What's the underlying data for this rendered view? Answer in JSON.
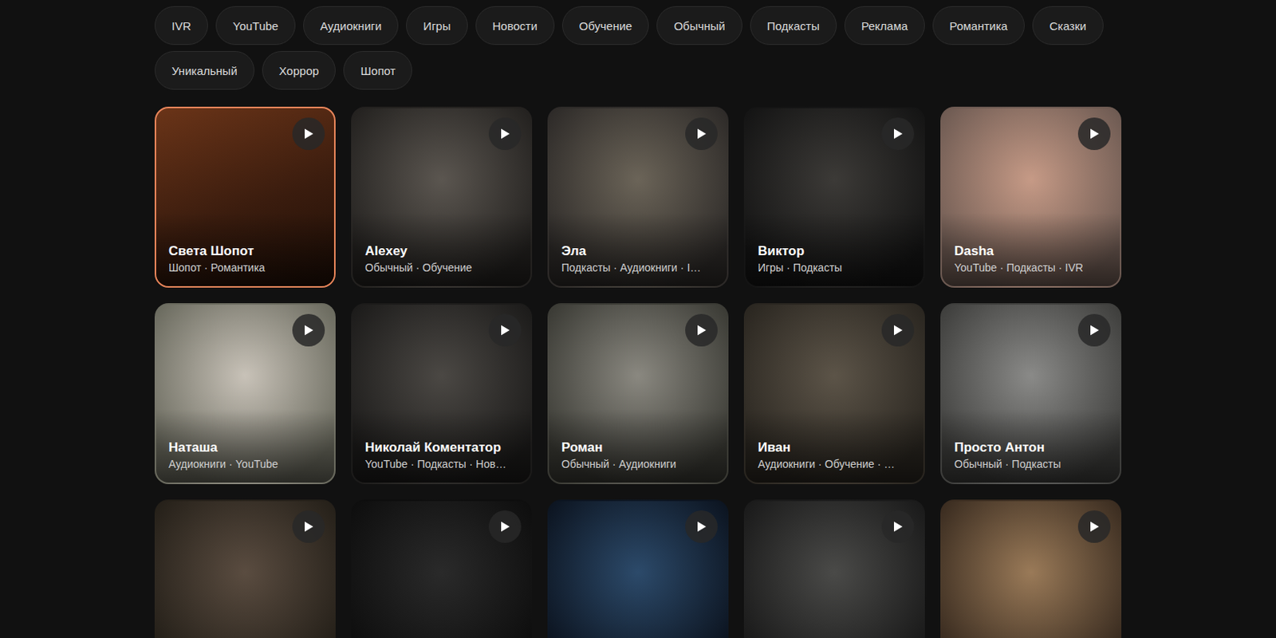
{
  "filters": [
    {
      "label": "IVR",
      "selected": false
    },
    {
      "label": "YouTube",
      "selected": false
    },
    {
      "label": "Аудиокниги",
      "selected": false
    },
    {
      "label": "Игры",
      "selected": false
    },
    {
      "label": "Новости",
      "selected": false
    },
    {
      "label": "Обучение",
      "selected": false
    },
    {
      "label": "Обычный",
      "selected": false
    },
    {
      "label": "Подкасты",
      "selected": false
    },
    {
      "label": "Реклама",
      "selected": false
    },
    {
      "label": "Романтика",
      "selected": false
    },
    {
      "label": "Сказки",
      "selected": false
    },
    {
      "label": "Уникальный",
      "selected": false
    },
    {
      "label": "Хоррор",
      "selected": false
    },
    {
      "label": "Шопот",
      "selected": false
    }
  ],
  "voices": [
    {
      "name": "Света Шопот",
      "tags": "Шопот · Романтика",
      "selected": true
    },
    {
      "name": "Alexey",
      "tags": "Обычный · Обучение",
      "selected": false
    },
    {
      "name": "Эла",
      "tags": "Подкасты · Аудиокниги · I…",
      "selected": false
    },
    {
      "name": "Виктор",
      "tags": "Игры · Подкасты",
      "selected": false
    },
    {
      "name": "Dasha",
      "tags": "YouTube · Подкасты · IVR",
      "selected": false
    },
    {
      "name": "Наташа",
      "tags": "Аудиокниги · YouTube",
      "selected": false
    },
    {
      "name": "Николай Коментатор",
      "tags": "YouTube · Подкасты · Нов…",
      "selected": false
    },
    {
      "name": "Роман",
      "tags": "Обычный · Аудиокниги",
      "selected": false
    },
    {
      "name": "Иван",
      "tags": "Аудиокниги · Обучение · …",
      "selected": false
    },
    {
      "name": "Просто Антон",
      "tags": "Обычный · Подкасты",
      "selected": false
    },
    {
      "selected": false
    },
    {
      "selected": false
    },
    {
      "selected": false
    },
    {
      "selected": false
    },
    {
      "selected": false
    }
  ]
}
